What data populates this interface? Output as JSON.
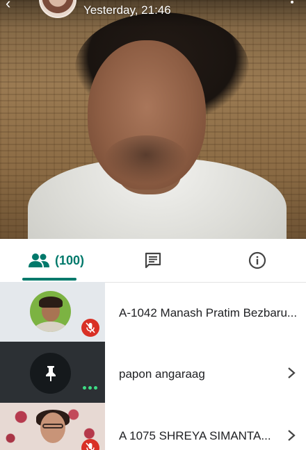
{
  "header": {
    "timestamp": "Yesterday, 21:46"
  },
  "video": {
    "subject": "active-speaker-video"
  },
  "tabs": [
    {
      "id": "people",
      "icon": "people-icon",
      "count_label": "(100)",
      "active": true
    },
    {
      "id": "chat",
      "icon": "chat-icon",
      "active": false
    },
    {
      "id": "info",
      "icon": "info-icon",
      "active": false
    }
  ],
  "participants": [
    {
      "name": "A-1042 Manash Pratim Bezbaru...",
      "muted": true,
      "tile": "avatar",
      "avatar_color": "#7cb342"
    },
    {
      "name": "papon angaraag",
      "muted": false,
      "tile": "pinned",
      "has_chevron": true
    },
    {
      "name": "A 1075 SHREYA SIMANTA...",
      "muted": true,
      "tile": "video",
      "has_chevron": true
    }
  ],
  "colors": {
    "accent": "#00796b",
    "mic_off": "#d93025",
    "more_dots": "#3ddc84"
  }
}
